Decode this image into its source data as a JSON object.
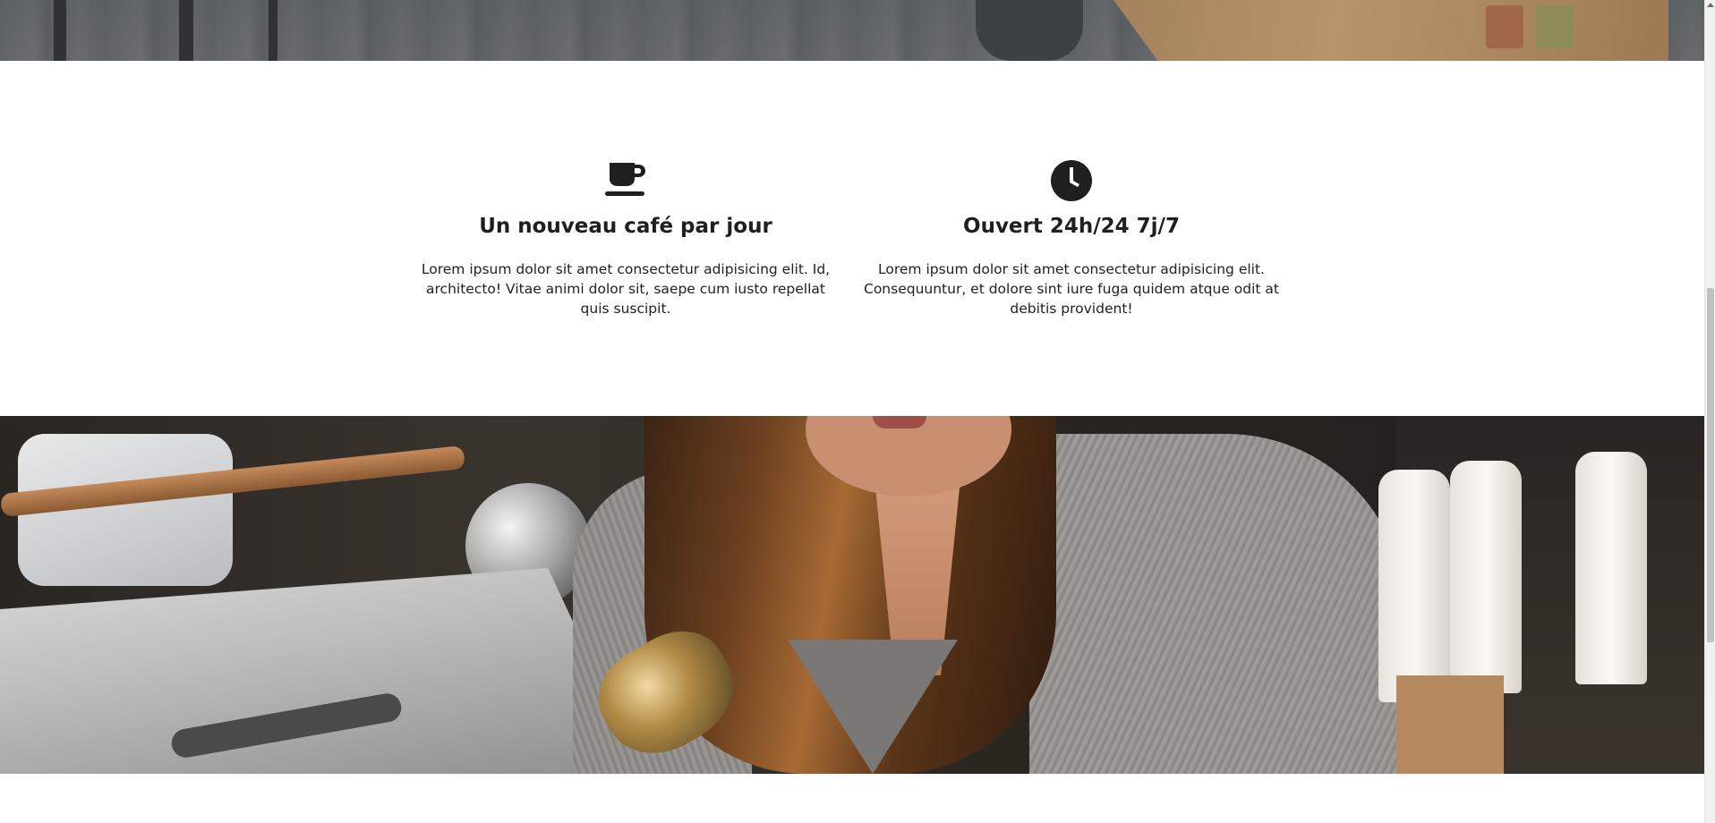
{
  "features": [
    {
      "icon": "coffee-cup-icon",
      "title": "Un nouveau café par jour",
      "text": "Lorem ipsum dolor sit amet consectetur adipisicing elit. Id, architecto! Vitae animi dolor sit, saepe cum iusto repellat quis suscipit."
    },
    {
      "icon": "clock-icon",
      "title": "Ouvert 24h/24 7j/7",
      "text": "Lorem ipsum dolor sit amet consectetur adipisicing elit. Consequuntur, et dolore sint iure fuga quidem atque odit at debitis provident!"
    }
  ],
  "colors": {
    "text": "#1f1f1f",
    "background": "#ffffff",
    "icon": "#1f1f1f"
  }
}
